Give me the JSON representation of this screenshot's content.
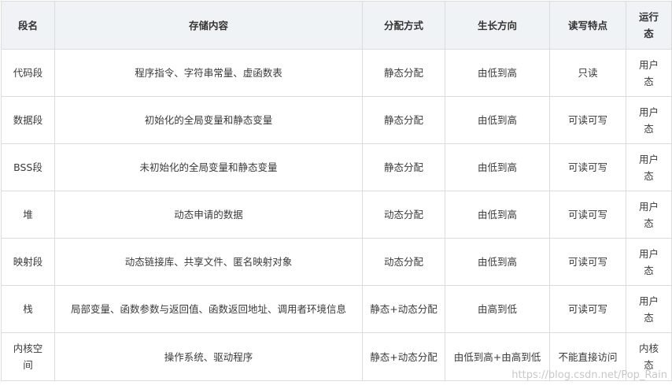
{
  "table": {
    "headers": [
      "段名",
      "存储内容",
      "分配方式",
      "生长方向",
      "读写特点",
      "运行态"
    ],
    "rows": [
      [
        "代码段",
        "程序指令、字符串常量、虚函数表",
        "静态分配",
        "由低到高",
        "只读",
        "用户态"
      ],
      [
        "数据段",
        "初始化的全局变量和静态变量",
        "静态分配",
        "由低到高",
        "可读可写",
        "用户态"
      ],
      [
        "BSS段",
        "未初始化的全局变量和静态变量",
        "静态分配",
        "由低到高",
        "可读可写",
        "用户态"
      ],
      [
        "堆",
        "动态申请的数据",
        "动态分配",
        "由低到高",
        "可读可写",
        "用户态"
      ],
      [
        "映射段",
        "动态链接库、共享文件、匿名映射对象",
        "动态分配",
        "由低到高",
        "可读可写",
        "用户态"
      ],
      [
        "栈",
        "局部变量、函数参数与返回值、函数返回地址、调用者环境信息",
        "静态+动态分配",
        "由高到低",
        "可读可写",
        "用户态"
      ],
      [
        "内核空间",
        "操作系统、驱动程序",
        "静态+动态分配",
        "由低到高+由高到低",
        "不能直接访问",
        "内核态"
      ]
    ]
  },
  "watermark": "https://blog.csdn.net/Pop_Rain"
}
